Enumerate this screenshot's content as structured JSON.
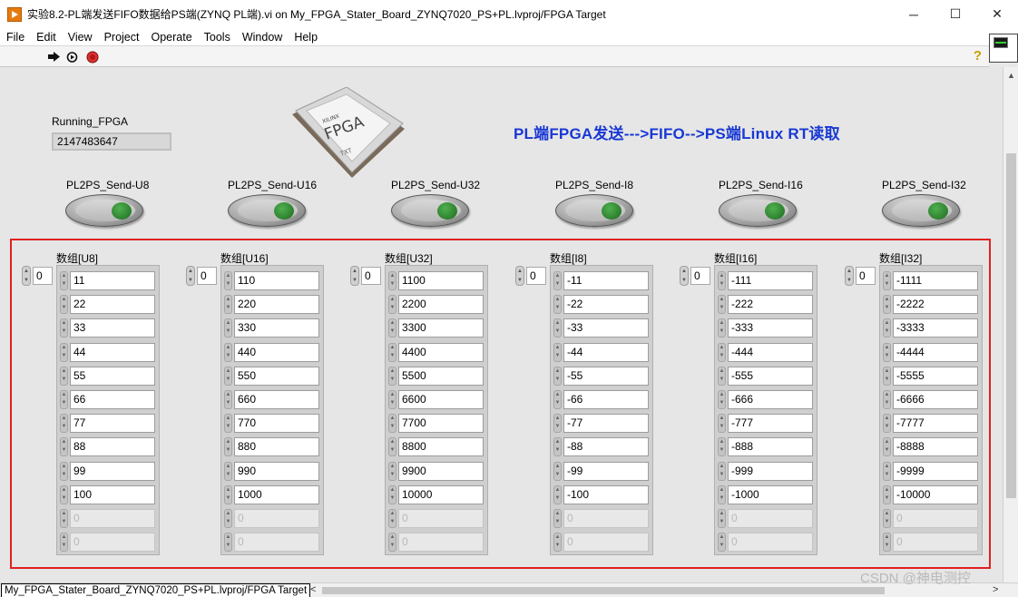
{
  "window": {
    "title": "实验8.2-PL端发送FIFO数据给PS端(ZYNQ PL端).vi on My_FPGA_Stater_Board_ZYNQ7020_PS+PL.lvproj/FPGA Target",
    "minimize": "─",
    "maximize": "☐",
    "close": "✕"
  },
  "menu": [
    "File",
    "Edit",
    "View",
    "Project",
    "Operate",
    "Tools",
    "Window",
    "Help"
  ],
  "toolbar": {
    "run_icon": "run-arrow-icon",
    "run_continuously_icon": "run-continuously-icon",
    "abort_icon": "abort-stop-icon",
    "help_icon": "context-help-icon",
    "help_glyph": "?"
  },
  "panel": {
    "running_label": "Running_FPGA",
    "running_value": "2147483647",
    "chip_text": "FPGA",
    "chip_sub": "TXT",
    "chip_brand": "XILINX",
    "headline": "PL端FPGA发送--->FIFO-->PS端Linux RT读取",
    "buttons": [
      {
        "label": "PL2PS_Send-U8"
      },
      {
        "label": "PL2PS_Send-U16"
      },
      {
        "label": "PL2PS_Send-U32"
      },
      {
        "label": "PL2PS_Send-I8"
      },
      {
        "label": "PL2PS_Send-I16"
      },
      {
        "label": "PL2PS_Send-I32"
      }
    ],
    "arrays": [
      {
        "label": "数组[U8]",
        "index": "0",
        "values": [
          "11",
          "22",
          "33",
          "44",
          "55",
          "66",
          "77",
          "88",
          "99",
          "100",
          "0",
          "0"
        ]
      },
      {
        "label": "数组[U16]",
        "index": "0",
        "values": [
          "110",
          "220",
          "330",
          "440",
          "550",
          "660",
          "770",
          "880",
          "990",
          "1000",
          "0",
          "0"
        ]
      },
      {
        "label": "数组[U32]",
        "index": "0",
        "values": [
          "1100",
          "2200",
          "3300",
          "4400",
          "5500",
          "6600",
          "7700",
          "8800",
          "9900",
          "10000",
          "0",
          "0"
        ]
      },
      {
        "label": "数组[I8]",
        "index": "0",
        "values": [
          "-11",
          "-22",
          "-33",
          "-44",
          "-55",
          "-66",
          "-77",
          "-88",
          "-99",
          "-100",
          "0",
          "0"
        ]
      },
      {
        "label": "数组[I16]",
        "index": "0",
        "values": [
          "-111",
          "-222",
          "-333",
          "-444",
          "-555",
          "-666",
          "-777",
          "-888",
          "-999",
          "-1000",
          "0",
          "0"
        ]
      },
      {
        "label": "数组[I32]",
        "index": "0",
        "values": [
          "-1111",
          "-2222",
          "-3333",
          "-4444",
          "-5555",
          "-6666",
          "-7777",
          "-8888",
          "-9999",
          "-10000",
          "0",
          "0"
        ]
      }
    ],
    "active_rows": 10
  },
  "status": {
    "target": "My_FPGA_Stater_Board_ZYNQ7020_PS+PL.lvproj/FPGA Target",
    "scroll_left": "<",
    "scroll_right": ">"
  },
  "watermark": "CSDN @神电测控",
  "colors": {
    "headline": "#1838d4",
    "frame": "#e02020",
    "led": "#2e8b2e"
  }
}
